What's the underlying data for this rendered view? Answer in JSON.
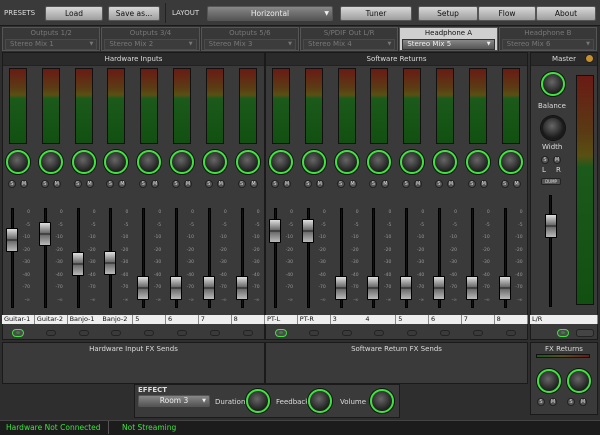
{
  "toolbar": {
    "presets_label": "PRESETS",
    "load_label": "Load",
    "saveas_label": "Save as...",
    "layout_label": "LAYOUT",
    "layout_value": "Horizontal",
    "tuner_label": "Tuner",
    "setup_label": "Setup",
    "flow_label": "Flow",
    "about_label": "About"
  },
  "outputs": [
    {
      "name": "Outputs 1/2",
      "mix": "Stereo Mix 1",
      "active": false
    },
    {
      "name": "Outputs 3/4",
      "mix": "Stereo Mix 2",
      "active": false
    },
    {
      "name": "Outputs 5/6",
      "mix": "Stereo Mix 3",
      "active": false
    },
    {
      "name": "S/PDIF Out L/R",
      "mix": "Stereo Mix 4",
      "active": false
    },
    {
      "name": "Headphone A",
      "mix": "Stereo Mix 5",
      "active": true
    },
    {
      "name": "Headphone B",
      "mix": "Stereo Mix 6",
      "active": false
    }
  ],
  "sections": {
    "hardware_inputs": "Hardware Inputs",
    "software_returns": "Software Returns",
    "master": "Master",
    "hw_fx_sends": "Hardware Input FX Sends",
    "sw_fx_sends": "Software Return FX Sends",
    "fx_returns": "FX Returns"
  },
  "channel_labels": [
    "Guitar-1",
    "Guitar-2",
    "Banjo-1",
    "Banjo-2",
    "5",
    "6",
    "7",
    "8",
    "PT-L",
    "PT-R",
    "3",
    "4",
    "5",
    "6",
    "7",
    "8"
  ],
  "master": {
    "balance_label": "Balance",
    "width_label": "Width",
    "l_label": "L",
    "r_label": "R",
    "channel_label": "L/R",
    "link_icon": "link-icon"
  },
  "scale_marks": [
    "0",
    "-5",
    "-10",
    "-20",
    "-30",
    "-40",
    "-70",
    "-∞"
  ],
  "solo_mute": {
    "s": "S",
    "m": "M"
  },
  "effect": {
    "section_label": "EFFECT",
    "preset": "Room 3",
    "duration_label": "Duration",
    "feedback_label": "Feedback",
    "volume_label": "Volume"
  },
  "status": {
    "hardware": "Hardware Not Connected",
    "streaming": "Not Streaming"
  },
  "levels": {
    "fader_positions": [
      0.74,
      0.82,
      0.42,
      0.44,
      0.1,
      0.1,
      0.1,
      0.1,
      0.85,
      0.85,
      0.1,
      0.1,
      0.1,
      0.1,
      0.1,
      0.1
    ],
    "master_fader": 0.78
  }
}
